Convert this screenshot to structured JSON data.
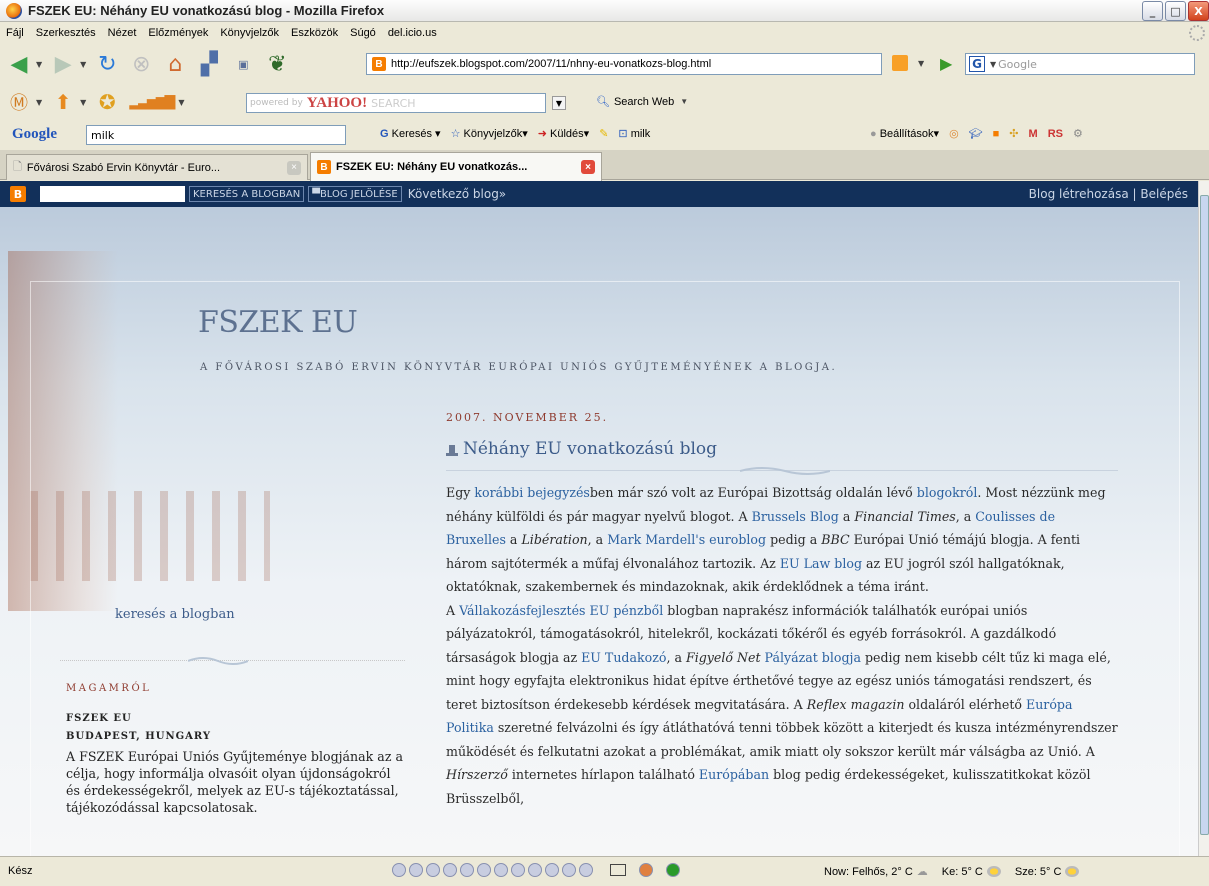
{
  "window": {
    "title": "FSZEK EU: Néhány EU vonatkozású blog - Mozilla Firefox",
    "buttons": [
      "_",
      "□",
      "X"
    ]
  },
  "menubar": [
    "Fájl",
    "Szerkesztés",
    "Nézet",
    "Előzmények",
    "Könyvjelzők",
    "Eszközök",
    "Súgó",
    "del.icio.us"
  ],
  "navbar": {
    "url": "http://eufszek.blogspot.com/2007/11/nhny-eu-vonatkozs-blog.html",
    "search_placeholder": "Google"
  },
  "yahoo_toolbar": {
    "powered": "powered by",
    "logo": "YAHOO!",
    "search_label": "SEARCH",
    "search_web": "Search Web"
  },
  "google_toolbar": {
    "logo": "Google",
    "query": "milk",
    "search_btn": "Keresés",
    "bookmarks": "Könyvjelzők",
    "send": "Küldés",
    "milk_btn": "milk",
    "settings": "Beállítások",
    "rs": "RS"
  },
  "tabs": [
    {
      "label": "Fővárosi Szabó Ervin Könyvtár - Euro..."
    },
    {
      "label": "FSZEK EU: Néhány EU vonatkozás..."
    }
  ],
  "blogger_nav": {
    "search_btn": "KERESÉS A BLOGBAN",
    "flag_btn": "BLOG JELÖLÉSE",
    "next": "Következő blog»",
    "create": "Blog létrehozása",
    "sep": "|",
    "login": "Belépés"
  },
  "blog": {
    "title": "FSZEK EU",
    "description": "A FŐVÁROSI SZABÓ ERVIN KÖNYVTÁR EURÓPAI UNIÓS GYŰJTEMÉNYÉNEK A BLOGJA."
  },
  "post": {
    "date": "2007. NOVEMBER 25.",
    "title": "Néhány EU vonatkozású blog",
    "p1": {
      "t1": "Egy ",
      "a1": "korábbi bejegyzés",
      "t2": "ben már szó volt az Európai Bizottság oldalán lévő ",
      "a2": "blogokról",
      "t3": ". Most nézzünk meg néhány külföldi és pár magyar nyelvű blogot. A ",
      "a3": "Brussels Blog",
      "t4": " a ",
      "i1": "Financial Times",
      "t5": ", a ",
      "a4": "Coulisses de Bruxelles",
      "t6": " a ",
      "i2": "Libération",
      "t7": ", a ",
      "a5": "Mark Mardell's euroblog",
      "t8": " pedig a ",
      "i3": "BBC",
      "t9": " Európai Unió témájú blogja. A fenti három sajtótermék a műfaj élvonalához tartozik. Az ",
      "a6": "EU Law blog",
      "t10": " az EU jogról szól hallgatóknak, oktatóknak, szakembernek és mindazoknak, akik érdeklődnek a téma iránt."
    },
    "p2": {
      "t1": "A ",
      "a1": "Vállakozásfejlesztés EU pénzből",
      "t2": " blogban naprakész információk találhatók európai uniós pályázatokról, támogatásokról, hitelekről, kockázati tőkéről és egyéb forrásokról. A gazdálkodó társaságok blogja az ",
      "a2": "EU Tudakozó",
      "t3": ", a ",
      "i1": "Figyelő Net",
      "t4": " ",
      "a3": "Pályázat blogja",
      "t5": " pedig nem kisebb célt tűz ki maga elé, mint hogy egyfajta elektronikus hidat építve érthetővé tegye az egész uniós támogatási rendszert, és teret biztosítson érdekesebb kérdések megvitatására. A ",
      "i2": "Reflex magazin",
      "t6": " oldaláról elérhető ",
      "a4": "Európa Politika",
      "t7": " szeretné felvázolni és így átláthatóvá tenni többek között a kiterjedt és kusza intézményrendszer működését és felkutatni azokat a problémákat, amik miatt oly sokszor került már válságba az Unió. A ",
      "i3": "Hírszerző",
      "t8": " internetes hírlapon található ",
      "a5": "Európában",
      "t9": " blog pedig érdekességeket, kulisszatitkokat közöl Brüsszelből,"
    }
  },
  "sidebar": {
    "search_link": "keresés a blogban",
    "about_heading": "MAGAMRÓL",
    "about_name": "FSZEK EU",
    "about_location": "BUDAPEST, HUNGARY",
    "about_text": "A FSZEK Európai Uniós Gyűjteménye blogjának az a célja, hogy informálja olvasóit olyan újdonságokról és érdekességekről, melyek az EU-s tájékoztatással, tájékozódással kapcsolatosak."
  },
  "statusbar": {
    "ready": "Kész",
    "weather_now": "Now: Felhős, 2° C",
    "weather_tue": "Ke: 5° C",
    "weather_wed": "Sze: 5° C"
  },
  "colors": {
    "blogger_bar": "#12305a",
    "link": "#2b61a0",
    "date_red": "#8f3b2f",
    "title_blue": "#5d7190"
  }
}
